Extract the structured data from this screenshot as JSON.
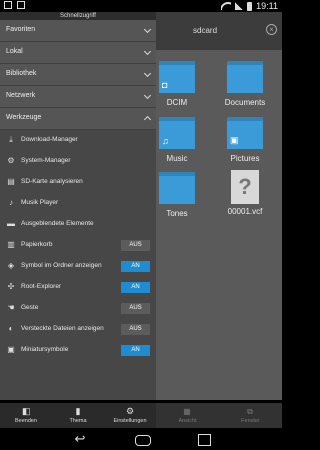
{
  "statusbar": {
    "time": "19:11"
  },
  "background": {
    "path": "sdcard",
    "close_icon": "close-circle-icon",
    "items": [
      {
        "label": "DCIM",
        "kind": "folder",
        "symbol": "camera-icon"
      },
      {
        "label": "Documents",
        "kind": "folder",
        "symbol": ""
      },
      {
        "label": "Music",
        "kind": "folder",
        "symbol": "music-note-icon"
      },
      {
        "label": "Pictures",
        "kind": "folder",
        "symbol": "image-icon"
      },
      {
        "label": "Tones",
        "kind": "folder",
        "symbol": ""
      },
      {
        "label": "00001.vcf",
        "kind": "file",
        "symbol": "question-mark-icon"
      }
    ],
    "bottom": [
      {
        "label": "Ansicht",
        "icon": "grid-icon"
      },
      {
        "label": "Fenster",
        "icon": "windows-icon"
      }
    ]
  },
  "drawer": {
    "header": "Schnellzugriff",
    "sections": [
      {
        "label": "Favoriten",
        "expanded": false
      },
      {
        "label": "Lokal",
        "expanded": false
      },
      {
        "label": "Bibliothek",
        "expanded": false
      },
      {
        "label": "Netzwerk",
        "expanded": false
      },
      {
        "label": "Werkzeuge",
        "expanded": true
      }
    ],
    "tools": [
      {
        "label": "Download-Manager",
        "icon": "download-icon"
      },
      {
        "label": "System-Manager",
        "icon": "system-icon"
      },
      {
        "label": "SD-Karte analysieren",
        "icon": "sd-card-icon"
      },
      {
        "label": "Musik Player",
        "icon": "music-player-icon"
      },
      {
        "label": "Ausgeblendete Elemente",
        "icon": "folder-icon"
      }
    ],
    "toggles": [
      {
        "label": "Papierkorb",
        "icon": "trash-icon",
        "value": "AUS",
        "on": false
      },
      {
        "label": "Symbol im Ordner anzeigen",
        "icon": "thumbnail-icon",
        "value": "AN",
        "on": true
      },
      {
        "label": "Root-Explorer",
        "icon": "root-icon",
        "value": "AN",
        "on": true
      },
      {
        "label": "Geste",
        "icon": "gesture-icon",
        "value": "AUS",
        "on": false
      },
      {
        "label": "Versteckte Dateien anzeigen",
        "icon": "hidden-files-icon",
        "value": "AUS",
        "on": false
      },
      {
        "label": "Miniatursymbole",
        "icon": "image-icon",
        "value": "AN",
        "on": true
      }
    ],
    "bottom": [
      {
        "label": "Beenden",
        "icon": "exit-icon"
      },
      {
        "label": "Thema",
        "icon": "theme-icon"
      },
      {
        "label": "Einstellungen",
        "icon": "gear-icon"
      }
    ]
  }
}
